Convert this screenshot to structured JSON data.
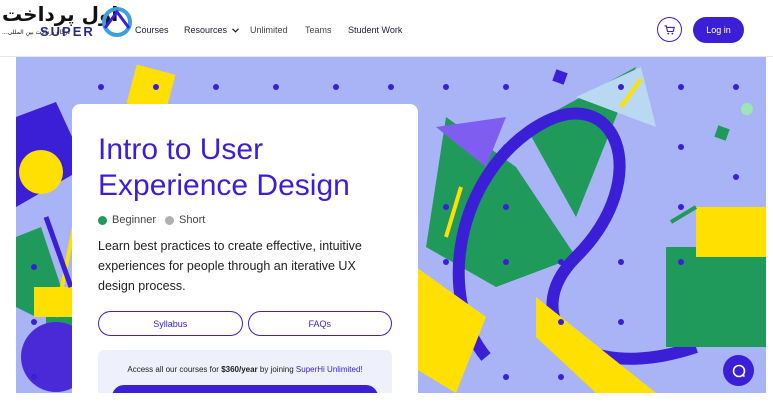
{
  "brand": {
    "arabic_title": "اول پرداخت",
    "arabic_subtitle": "...درگاه پرداخت بین المللی",
    "name": "SUPER"
  },
  "nav": {
    "courses": "Courses",
    "resources": "Resources",
    "unlimited": "Unlimited",
    "teams": "Teams",
    "student_work": "Student Work",
    "login": "Log in"
  },
  "course": {
    "title_line1": "Intro to User",
    "title_line2": "Experience Design",
    "level_beginner": "Beginner",
    "level_short": "Short",
    "description": "Learn best practices to create effective, intuitive experiences for people through an iterative UX design process.",
    "syllabus": "Syllabus",
    "faqs": "FAQs"
  },
  "promo": {
    "text_before": "Access all our courses for ",
    "price": "$360/year",
    "text_middle": " by joining ",
    "link": "SuperHi Unlimited!"
  },
  "colors": {
    "primary": "#3a1fd6",
    "green": "#1f9a5a",
    "yellow": "#ffe000",
    "lavender": "#a9b4f6"
  },
  "icons": [
    "cart-icon",
    "chevron-down-icon",
    "chat-icon",
    "logo-mark-icon"
  ]
}
